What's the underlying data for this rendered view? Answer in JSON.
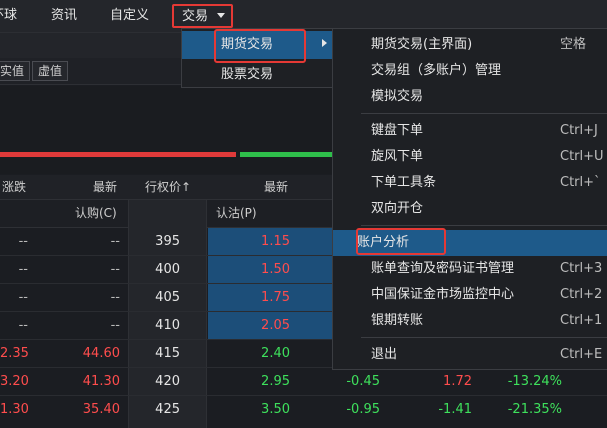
{
  "menubar": {
    "items": [
      "环球",
      "资讯",
      "自定义",
      "交易"
    ]
  },
  "toolbar": {
    "buttons": [
      "实值",
      "虚值"
    ]
  },
  "table": {
    "headers": [
      "涨跌",
      "最新",
      "行权价↑",
      "最新"
    ],
    "subheaders": {
      "call": "认购(C)",
      "put": "认沽(P)"
    },
    "rows": [
      {
        "change": "--",
        "call_last": "--",
        "strike": "395",
        "put_last": "1.15",
        "put_change": "",
        "put_other": "",
        "put_pct": ""
      },
      {
        "change": "--",
        "call_last": "--",
        "strike": "400",
        "put_last": "1.50",
        "put_change": "",
        "put_other": "",
        "put_pct": ""
      },
      {
        "change": "--",
        "call_last": "--",
        "strike": "405",
        "put_last": "1.75",
        "put_change": "",
        "put_other": "",
        "put_pct": ""
      },
      {
        "change": "--",
        "call_last": "--",
        "strike": "410",
        "put_last": "2.05",
        "put_change": "",
        "put_other": "",
        "put_pct": ""
      },
      {
        "change": "2.35",
        "call_last": "44.60",
        "strike": "415",
        "put_last": "2.40",
        "put_change": "",
        "put_other": "",
        "put_pct": ""
      },
      {
        "change": "3.20",
        "call_last": "41.30",
        "strike": "420",
        "put_last": "2.95",
        "put_change": "-0.45",
        "put_other": "1.72",
        "put_pct": "-13.24%"
      },
      {
        "change": "1.30",
        "call_last": "35.40",
        "strike": "425",
        "put_last": "3.50",
        "put_change": "-0.95",
        "put_other": "-1.41",
        "put_pct": "-21.35%"
      }
    ]
  },
  "menu_trade": {
    "items": [
      {
        "label": "期货交易",
        "has_submenu": true
      },
      {
        "label": "股票交易",
        "has_submenu": false
      }
    ]
  },
  "menu_futures": {
    "items": [
      {
        "label": "期货交易(主界面)",
        "shortcut": "空格"
      },
      {
        "label": "交易组（多账户）管理",
        "shortcut": ""
      },
      {
        "label": "模拟交易",
        "shortcut": ""
      },
      {
        "label": "键盘下单",
        "shortcut": "Ctrl+J"
      },
      {
        "label": "旋风下单",
        "shortcut": "Ctrl+U"
      },
      {
        "label": "下单工具条",
        "shortcut": "Ctrl+`"
      },
      {
        "label": "双向开仓",
        "shortcut": ""
      },
      {
        "label": "账户分析",
        "shortcut": ""
      },
      {
        "label": "账单查询及密码证书管理",
        "shortcut": "Ctrl+3"
      },
      {
        "label": "中国保证金市场监控中心",
        "shortcut": "Ctrl+2"
      },
      {
        "label": "银期转账",
        "shortcut": "Ctrl+1"
      },
      {
        "label": "退出",
        "shortcut": "Ctrl+E"
      }
    ]
  },
  "colors": {
    "accent": "#1e5a8a",
    "highlight_box": "#e53935",
    "up": "#ff4d4d",
    "down": "#3ee05c"
  }
}
